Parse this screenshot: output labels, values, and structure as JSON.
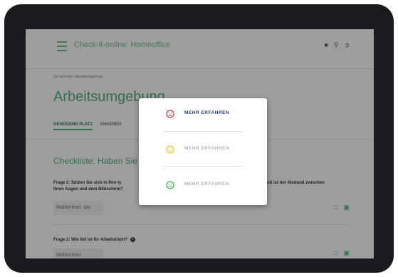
{
  "app": {
    "title": "Check-it-online: Homeoffice"
  },
  "breadcrumb": "Sie sind hier: Arbeitsumgebung",
  "page_title": "Arbeitsumgebung",
  "tabs": [
    {
      "label": "GENÜGEND PLATZ"
    },
    {
      "label": "ANGENEH"
    }
  ],
  "section_title": "Checkliste: Haben Sie g",
  "question1": {
    "text_left": "Frage 1: Setzen Sie sich in Ihre ty",
    "text_left_line2": "Ihren Augen und dem Bildschirm?",
    "text_right": "groß ist der Abstand zwischen",
    "field_placeholder": "Maßeinheit",
    "unit": "cm"
  },
  "question2": {
    "text": "Frage 2: Wie tief ist Ihr Arbeitstisch?",
    "field_placeholder": "Maßeinheit"
  },
  "modal": {
    "options": [
      {
        "label": "MEHR ERFAHREN",
        "icon": "sad-face-icon",
        "color": "#e53935",
        "label_color": "#2c3e73"
      },
      {
        "label": "MEHR ERFAHREN",
        "icon": "neutral-face-icon",
        "color": "#f4c430",
        "label_color": "#b5b5b5"
      },
      {
        "label": "MEHR ERFAHREN",
        "icon": "happy-face-icon",
        "color": "#3bb55c",
        "label_color": "#b5b5b5"
      }
    ]
  },
  "colors": {
    "accent": "#55b07d",
    "bezel": "#1a1a1c"
  }
}
